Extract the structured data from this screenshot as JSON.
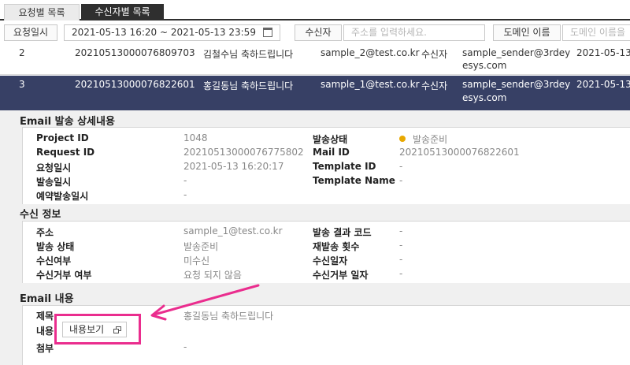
{
  "tabs": [
    {
      "label": "요청별 목록"
    },
    {
      "label": "수신자별 목록"
    }
  ],
  "filters": {
    "request_date_label": "요청일시",
    "date_range": "2021-05-13 16:20 ~ 2021-05-13 23:59",
    "recipient_label": "수신자",
    "recipient_placeholder": "주소를 입력하세요.",
    "domain_label": "도메인 이름",
    "domain_placeholder": "도메인 이름을"
  },
  "rows": [
    {
      "no": "2",
      "request_id": "20210513000076809703",
      "subject": "김철수님 축하드립니다",
      "recipient": "sample_2@test.co.kr",
      "type": "수신자",
      "sender": [
        "sample_sender@3rdey",
        "esys.com"
      ],
      "date": "2021-05-13"
    },
    {
      "no": "3",
      "request_id": "20210513000076822601",
      "subject": "홍길동님 축하드립니다",
      "recipient": "sample_1@test.co.kr",
      "type": "수신자",
      "sender": [
        "sample_sender@3rdey",
        "esys.com"
      ],
      "date": "2021-05-13"
    }
  ],
  "detail": {
    "title": "Email 발송 상세내용",
    "send": {
      "project_id_label": "Project ID",
      "project_id": "1048",
      "request_id_label": "Request ID",
      "request_id": "20210513000076775802",
      "request_date_label": "요청일시",
      "request_date": "2021-05-13 16:20:17",
      "send_date_label": "발송일시",
      "send_date": "-",
      "reserved_label": "예약발송일시",
      "reserved": "-",
      "status_label": "발송상태",
      "status": "발송준비",
      "mail_id_label": "Mail ID",
      "mail_id": "20210513000076822601",
      "template_id_label": "Template ID",
      "template_id": "-",
      "template_name_label": "Template Name",
      "template_name": "-",
      "status_color": "#e8a800"
    },
    "receive": {
      "title": "수신 정보",
      "address_label": "주소",
      "address": "sample_1@test.co.kr",
      "send_status_label": "발송 상태",
      "send_status": "발송준비",
      "received_label": "수신여부",
      "received": "미수신",
      "rejected_label": "수신거부 여부",
      "rejected": "요청 되지 않음",
      "result_code_label": "발송 결과 코드",
      "result_code": "-",
      "resend_label": "재발송 횟수",
      "resend": "-",
      "received_date_label": "수신일자",
      "received_date": "-",
      "rejected_date_label": "수신거부 일자",
      "rejected_date": "-"
    },
    "content": {
      "title": "Email 내용",
      "subject_label": "제목",
      "subject": "홍길동님 축하드립니다",
      "body_label": "내용",
      "view_button": "내용보기",
      "attach_label": "첨부",
      "attach": "-"
    }
  },
  "colors": {
    "selected_row": "#374065",
    "highlight": "#ea2d8e",
    "active_tab": "#2f2f2f"
  }
}
